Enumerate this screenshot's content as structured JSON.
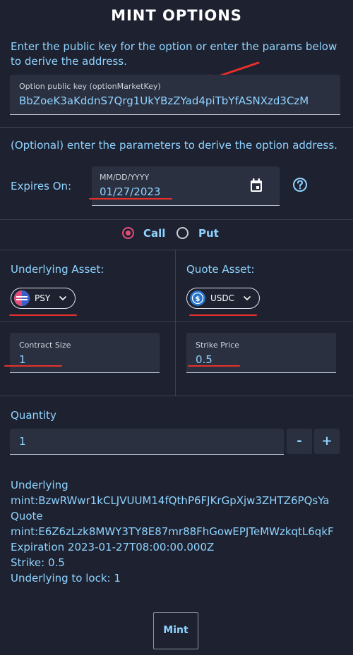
{
  "page": {
    "title": "MINT OPTIONS",
    "intro": "Enter the public key for the option or enter the params below to derive the address."
  },
  "public_key": {
    "label": "Option public key (optionMarketKey)",
    "value": "BbZoeK3aKddnS7Qrg1UkYBzZYad4piTbYfASNXzd3CzM"
  },
  "params": {
    "hint": "(Optional) enter the parameters to derive the option address.",
    "expires_label": "Expires On:",
    "date_format": "MM/DD/YYYY",
    "date_value": "01/27/2023"
  },
  "option_type": {
    "call_label": "Call",
    "put_label": "Put",
    "selected": "call",
    "accent": "#e24d7a"
  },
  "underlying": {
    "label": "Underlying Asset:",
    "asset": "PSY",
    "icon": "psy-token-icon"
  },
  "quote": {
    "label": "Quote Asset:",
    "asset": "USDC",
    "icon": "usdc-token-icon"
  },
  "contract": {
    "label": "Contract Size",
    "value": "1"
  },
  "strike": {
    "label": "Strike Price",
    "value": "0.5"
  },
  "quantity": {
    "label": "Quantity",
    "value": "1",
    "minus_label": "-",
    "plus_label": "+"
  },
  "info": {
    "underlying_label": "Underlying",
    "underlying_mint": "mint:BzwRWwr1kCLJVUUM14fQthP6FJKrGpXjw3ZHTZ6PQsYa",
    "quote_label": "Quote",
    "quote_mint": "mint:E6Z6zLzk8MWY3TY8E87mr88FhGowEPJTeMWzkqtL6qkF",
    "expiration": "Expiration 2023-01-27T08:00:00.000Z",
    "strike": "Strike: 0.5",
    "underlying_to_lock": "Underlying to lock: 1"
  },
  "actions": {
    "mint_label": "Mint"
  },
  "colors": {
    "background": "#1e2230",
    "field": "#2b3040",
    "text_accent": "#8fd3ff",
    "annotation": "#e8302a"
  }
}
